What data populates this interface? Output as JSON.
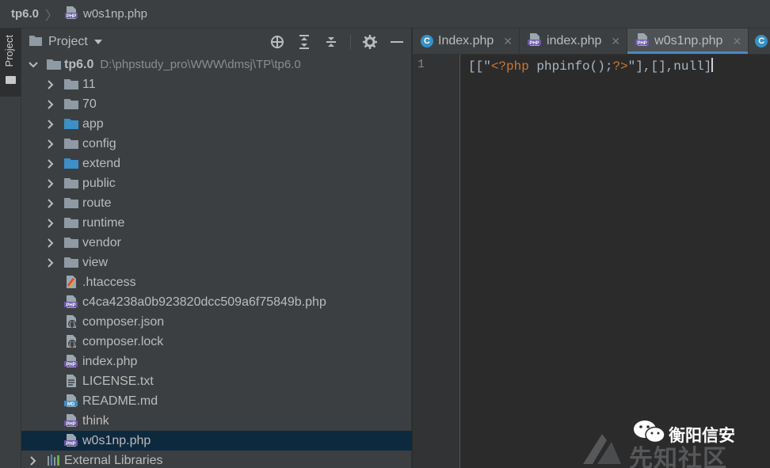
{
  "breadcrumb": {
    "project": "tp6.0",
    "file": "w0s1np.php"
  },
  "side_strip": {
    "tab_label": "Project"
  },
  "project_panel": {
    "title": "Project",
    "tree": [
      {
        "type": "root",
        "label": "tp6.0",
        "path": "D:\\phpstudy_pro\\WWW\\dmsj\\TP\\tp6.0",
        "expanded": true
      },
      {
        "type": "folder",
        "label": "11",
        "color": "gray"
      },
      {
        "type": "folder",
        "label": "70",
        "color": "gray"
      },
      {
        "type": "folder",
        "label": "app",
        "color": "blue"
      },
      {
        "type": "folder",
        "label": "config",
        "color": "gray"
      },
      {
        "type": "folder",
        "label": "extend",
        "color": "blue"
      },
      {
        "type": "folder",
        "label": "public",
        "color": "gray"
      },
      {
        "type": "folder",
        "label": "route",
        "color": "gray"
      },
      {
        "type": "folder",
        "label": "runtime",
        "color": "gray"
      },
      {
        "type": "folder",
        "label": "vendor",
        "color": "gray"
      },
      {
        "type": "folder",
        "label": "view",
        "color": "gray"
      },
      {
        "type": "file",
        "label": ".htaccess",
        "icon": "htaccess-icon"
      },
      {
        "type": "file",
        "label": "c4ca4238a0b923820dcc509a6f75849b.php",
        "icon": "php-file-icon"
      },
      {
        "type": "file",
        "label": "composer.json",
        "icon": "json-file-icon"
      },
      {
        "type": "file",
        "label": "composer.lock",
        "icon": "json-file-icon"
      },
      {
        "type": "file",
        "label": "index.php",
        "icon": "php-file-icon"
      },
      {
        "type": "file",
        "label": "LICENSE.txt",
        "icon": "text-file-icon"
      },
      {
        "type": "file",
        "label": "README.md",
        "icon": "markdown-file-icon"
      },
      {
        "type": "file",
        "label": "think",
        "icon": "php-file-icon"
      },
      {
        "type": "file",
        "label": "w0s1np.php",
        "icon": "php-file-icon",
        "selected": true
      },
      {
        "type": "library",
        "label": "External Libraries"
      }
    ]
  },
  "editor": {
    "tabs": [
      {
        "label": "Index.php",
        "icon": "class-icon",
        "active": false
      },
      {
        "label": "index.php",
        "icon": "php-file-icon",
        "active": false
      },
      {
        "label": "w0s1np.php",
        "icon": "php-file-icon",
        "active": true
      }
    ],
    "line_number": "1",
    "code": {
      "part1": "[[\"",
      "php_open": "<?php",
      "middle": " phpinfo();",
      "php_close": "?>",
      "part2": "\"],[],null]"
    }
  },
  "watermark": {
    "brand": "衡阳信安",
    "ghost": "先知社区"
  },
  "colors": {
    "selection": "#0d293e",
    "accent": "#4a88c7",
    "php_tag": "#cc7832",
    "folder_blue": "#3d8fc7",
    "folder_gray": "#8f9aa5"
  }
}
